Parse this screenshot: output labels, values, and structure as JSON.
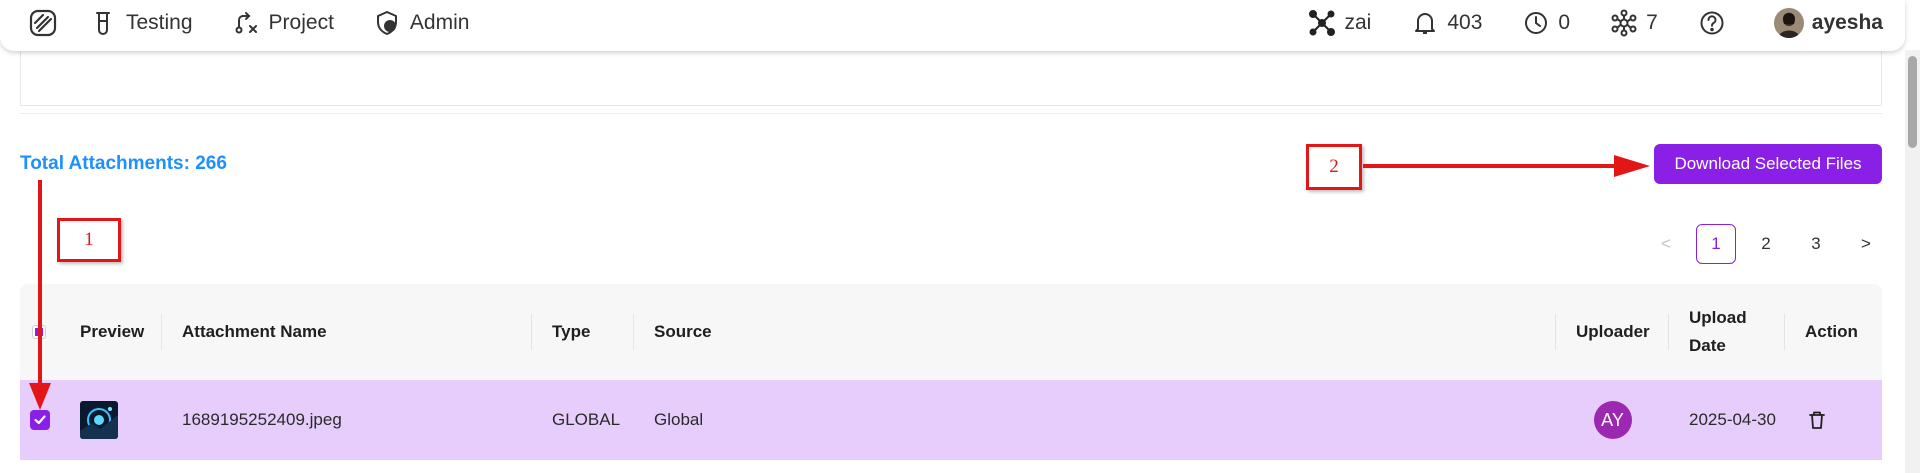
{
  "nav": {
    "items": [
      {
        "label": "Testing",
        "icon": "beaker-icon"
      },
      {
        "label": "Project",
        "icon": "workflow-icon"
      },
      {
        "label": "Admin",
        "icon": "shield-user-icon"
      }
    ],
    "workspace": "zai",
    "notifications": "403",
    "pending": "0",
    "nodes": "7",
    "user": "ayesha"
  },
  "attachments": {
    "total_label": "Total Attachments: 266",
    "download_label": "Download Selected Files"
  },
  "annotations": {
    "first": "1",
    "second": "2"
  },
  "pagination": {
    "prev": "<",
    "pages": [
      "1",
      "2",
      "3"
    ],
    "next": ">",
    "current": "1"
  },
  "table": {
    "headers": {
      "preview": "Preview",
      "name": "Attachment Name",
      "type": "Type",
      "source": "Source",
      "uploader": "Uploader",
      "upload_date_line1": "Upload",
      "upload_date_line2": "Date",
      "action": "Action"
    },
    "rows": [
      {
        "name": "1689195252409.jpeg",
        "type": "GLOBAL",
        "source": "Global",
        "uploader_initials": "AY",
        "upload_date": "2025-04-30",
        "selected": true
      }
    ]
  },
  "colors": {
    "accent": "#8a1fe6",
    "link": "#1e90ff",
    "selected_row": "#e6cdfc",
    "annotation": "#e21616",
    "uploader_avatar": "#9c27b0"
  }
}
